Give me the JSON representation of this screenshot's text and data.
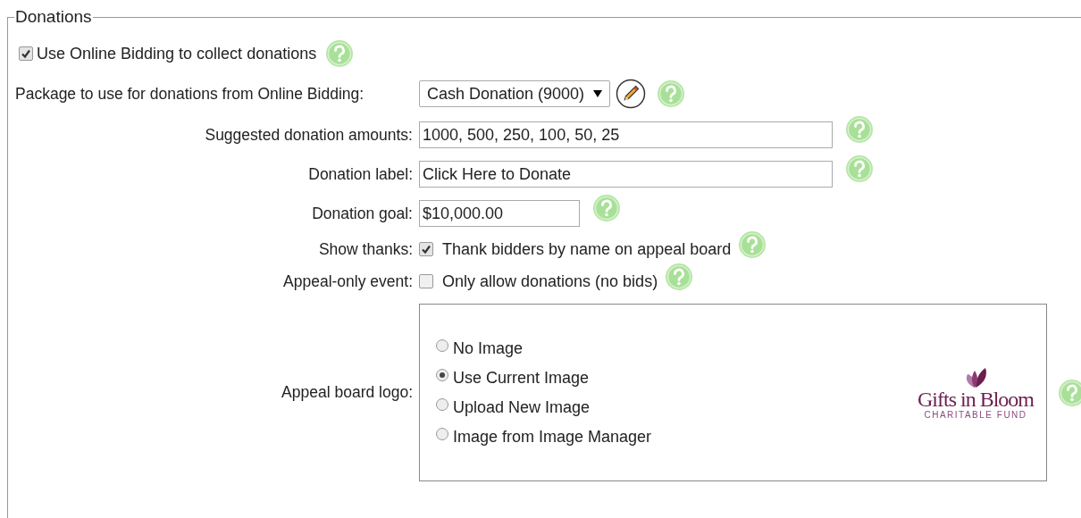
{
  "legend": "Donations",
  "use_online": {
    "label": "Use Online Bidding to collect donations",
    "checked": true
  },
  "fields": [
    {
      "kind": "select",
      "label": "Package to use for donations from Online Bidding:",
      "value": "Cash Donation (9000)"
    },
    {
      "kind": "text",
      "label": "Suggested donation amounts:",
      "value": "1000, 500, 250, 100, 50, 25"
    },
    {
      "kind": "text",
      "label": "Donation label:",
      "value": "Click Here to Donate"
    },
    {
      "kind": "money",
      "label": "Donation goal:",
      "value": "$10,000.00"
    },
    {
      "kind": "checkbox",
      "label": "Show thanks:",
      "text": "Thank bidders by name on appeal board",
      "checked": true
    },
    {
      "kind": "checkbox",
      "label": "Appeal-only event:",
      "text": "Only allow donations (no bids)",
      "checked": false
    },
    {
      "kind": "radio",
      "label": "Appeal board logo:",
      "options": [
        {
          "label": "No Image",
          "selected": false
        },
        {
          "label": "Use Current Image",
          "selected": true
        },
        {
          "label": "Upload New Image",
          "selected": false
        },
        {
          "label": "Image from Image Manager",
          "selected": false
        }
      ],
      "logo": {
        "name": "Gifts in Bloom",
        "tagline": "CHARITABLE FUND"
      }
    }
  ]
}
